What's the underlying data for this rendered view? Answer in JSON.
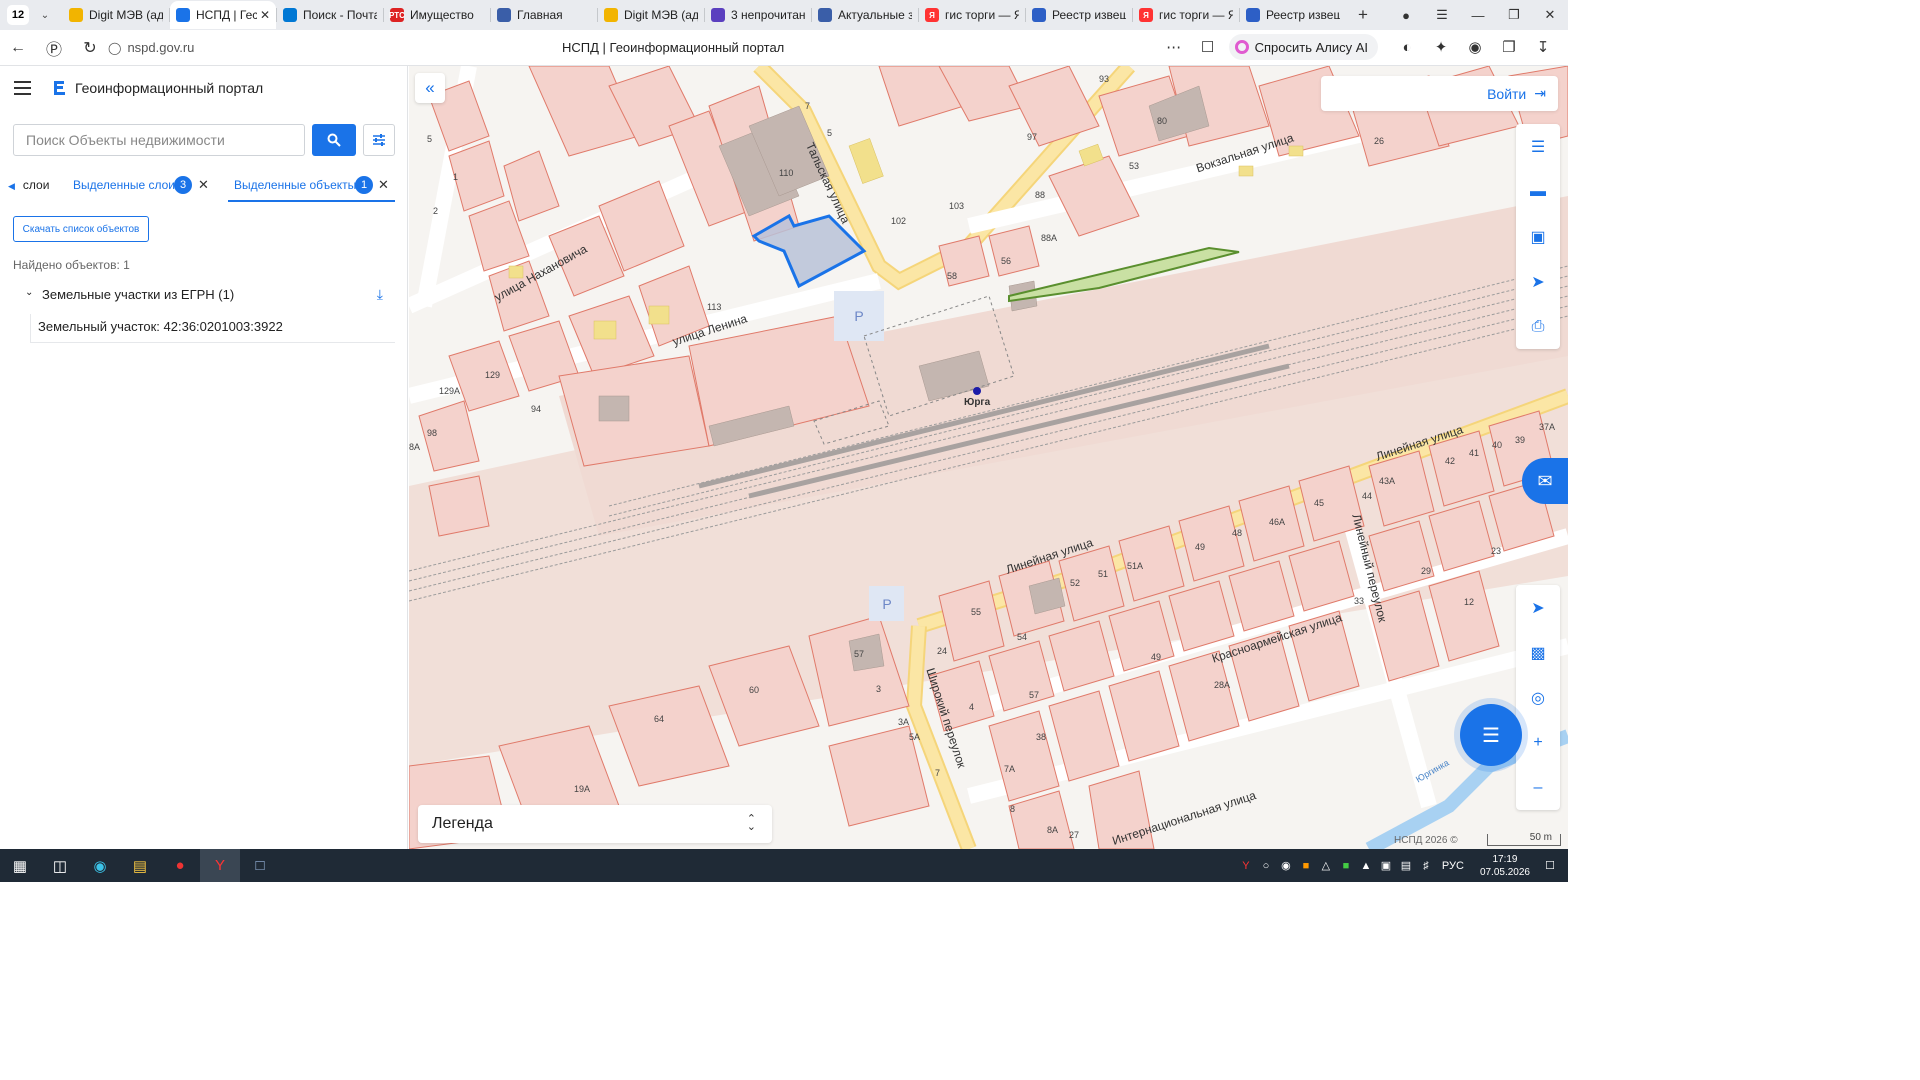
{
  "browser": {
    "tab_count": "12",
    "tabs": [
      {
        "title": "Digit МЭВ (ад",
        "color": "#f2b400",
        "glyph": ""
      },
      {
        "title": "НСПД | Гес",
        "color": "#1a73e8",
        "glyph": ""
      },
      {
        "title": "Поиск - Почта",
        "color": "#0078d4",
        "glyph": ""
      },
      {
        "title": "Имущество",
        "color": "#d22",
        "glyph": "РТС"
      },
      {
        "title": "Главная",
        "color": "#3a5ea8",
        "glyph": ""
      },
      {
        "title": "Digit МЭВ (ад",
        "color": "#f2b400",
        "glyph": ""
      },
      {
        "title": "3 непрочитан",
        "color": "#5b3fbf",
        "glyph": ""
      },
      {
        "title": "Актуальные з",
        "color": "#3a5ea8",
        "glyph": ""
      },
      {
        "title": "гис торги — Я",
        "color": "#f33",
        "glyph": "Я"
      },
      {
        "title": "Реестр извещ",
        "color": "#2d5fc6",
        "glyph": ""
      },
      {
        "title": "гис торги — Я",
        "color": "#f33",
        "glyph": "Я"
      },
      {
        "title": "Реестр извещ",
        "color": "#2d5fc6",
        "glyph": ""
      }
    ],
    "url": "nspd.gov.ru",
    "page_title": "НСПД | Геоинформационный портал",
    "alice_label": "Спросить Алису AI"
  },
  "sidebar": {
    "portal_title": "Геоинформационный портал",
    "search_placeholder": "Поиск Объекты недвижимости",
    "tab_layers": "слои",
    "tab_selected_layers": "Выделенные слои",
    "tab_selected_layers_count": "3",
    "tab_selected_objects": "Выделенные объекты",
    "tab_selected_objects_count": "1",
    "download_list_label": "Скачать список объектов",
    "found_text": "Найдено объектов: 1",
    "group_label": "Земельные участки из ЕГРН (1)",
    "object_label": "Земельный участок: 42:36:0201003:3922"
  },
  "map": {
    "login_label": "Войти",
    "legend_label": "Легенда",
    "copyright": "НСПД 2026 ©",
    "scale_label": "50 m",
    "street_labels": [
      "улица Нахановича",
      "Тальская улица",
      "улица Ленина",
      "Вокзальная улица",
      "Линейная улица",
      "Линейная улица",
      "Линейный переулок",
      "Красноармейская улица",
      "Широкий переулок",
      "Интернациональная улица",
      "Юрга",
      "Юргинка"
    ],
    "house_numbers": [
      "93",
      "7",
      "5",
      "97",
      "80",
      "26",
      "53",
      "110",
      "88",
      "102",
      "103",
      "88А",
      "56",
      "58",
      "113",
      "129",
      "129А",
      "94",
      "98",
      "8А",
      "5",
      "1",
      "2",
      "52",
      "51",
      "51А",
      "49",
      "48",
      "46А",
      "45",
      "44",
      "43А",
      "42",
      "41",
      "40",
      "39",
      "37А",
      "23",
      "29",
      "33",
      "12",
      "55",
      "54",
      "49",
      "28А",
      "24",
      "57",
      "3",
      "3А",
      "5А",
      "7",
      "4",
      "38",
      "7А",
      "8",
      "8А",
      "27",
      "60",
      "64",
      "19А",
      "57",
      "8"
    ],
    "accent": "#1a73e8",
    "parcel_selected_color": "#1a73e8",
    "parcel_green_color": "#5a8f2e"
  },
  "taskbar": {
    "lang": "РУС",
    "time": "17:19",
    "date": "07.05.2026"
  }
}
